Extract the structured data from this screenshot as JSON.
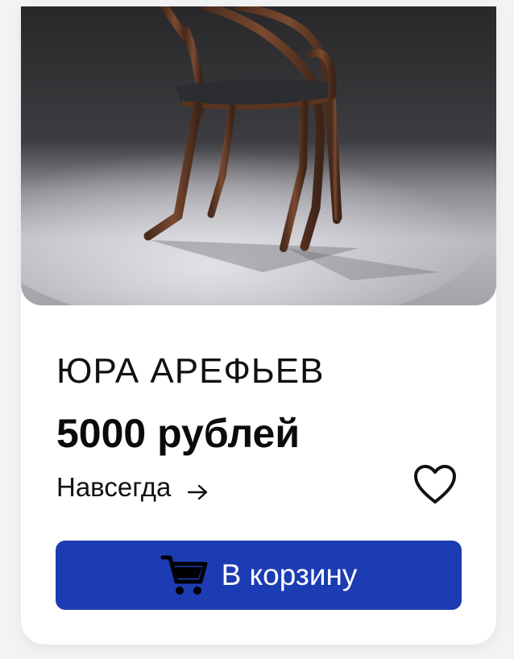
{
  "product": {
    "image_alt": "chair-photo",
    "title": "ЮРА АРЕФЬЕВ",
    "price": "5000 рублей",
    "duration": "Навсегда"
  },
  "actions": {
    "add_to_cart_label": "В корзину"
  },
  "icons": {
    "duration_arrow": "arrow-right-icon",
    "favorite": "heart-icon",
    "cart": "shopping-cart-icon"
  },
  "colors": {
    "accent": "#1c3cb3",
    "text": "#111111",
    "card": "#ffffff"
  }
}
